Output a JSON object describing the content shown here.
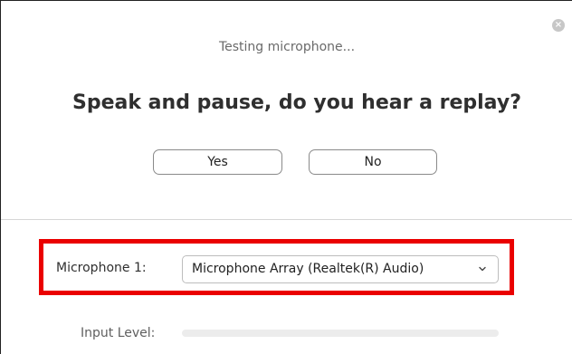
{
  "dialog": {
    "close_icon": "close-icon",
    "status": "Testing microphone...",
    "prompt": "Speak and pause, do you hear a replay?",
    "buttons": {
      "yes": "Yes",
      "no": "No"
    }
  },
  "microphone": {
    "label": "Microphone 1:",
    "selected": "Microphone Array (Realtek(R) Audio)",
    "dropdown_icon": "chevron-down-icon"
  },
  "input_level": {
    "label": "Input Level:",
    "level": 0
  },
  "colors": {
    "highlight": "#ea0000",
    "button_border": "#8a8a8a",
    "close_icon": "#c7c7c7"
  }
}
